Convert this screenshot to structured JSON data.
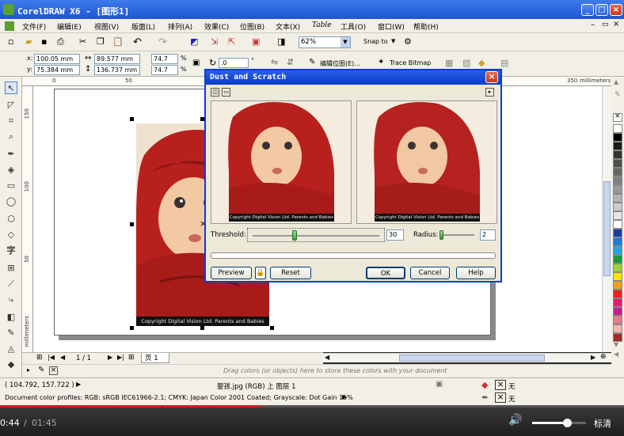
{
  "window": {
    "title": "CorelDRAW X6 - [图形1]"
  },
  "menu": [
    "文件(F)",
    "编辑(E)",
    "视图(V)",
    "版面(L)",
    "排列(A)",
    "效果(C)",
    "位图(B)",
    "文本(X)",
    "Table",
    "工具(O)",
    "窗口(W)",
    "帮助(H)"
  ],
  "toolbar": {
    "zoom": "62%",
    "snap_to": "Snap to",
    "edit_bitmap": "编辑位图(E)...",
    "trace_bitmap": "Trace Bitmap"
  },
  "props": {
    "x": "100.05 mm",
    "y": "75.384 mm",
    "w": "89.577 mm",
    "h": "136.737 mm",
    "sx": "74.7",
    "sy": "74.7",
    "pct": "%",
    "rotation": ".0",
    "deg": "°"
  },
  "ruler": {
    "unit": "millimeters",
    "h_ticks": [
      "0",
      "50",
      "350"
    ],
    "v_ticks": [
      "150",
      "100",
      "50"
    ],
    "v_unit": "millimeters"
  },
  "photo": {
    "caption": "Copyright Digital Vision Ltd. Parents and Babies"
  },
  "dialog": {
    "title": "Dust and Scratch",
    "threshold_label": "Threshold:",
    "threshold_value": "30",
    "radius_label": "Radius:",
    "radius_value": "2",
    "preview_label": "Preview",
    "reset_label": "Reset",
    "ok_label": "OK",
    "cancel_label": "Cancel",
    "help_label": "Help",
    "preview_caption": "Copyright Digital Vision Ltd. Parents and Babies"
  },
  "pagenav": {
    "counter": "1 / 1",
    "tab": "页 1"
  },
  "dropbar": {
    "hint": "Drag colors (or objects) here to store these colors with your document"
  },
  "status": {
    "coords": "( 104.792, 157.722 )",
    "object_info": "婴孩.jpg (RGB) 上 图层 1",
    "profiles": "Document color profiles: RGB: sRGB IEC61966-2.1; CMYK: Japan Color 2001 Coated; Grayscale: Dot Gain 15%",
    "fill_none": "无",
    "outline_none": "无"
  },
  "video": {
    "current": "0:44",
    "separator": "/",
    "duration": "01:45",
    "cc": "标清",
    "progress": 0.42,
    "volume": 0.65
  },
  "palette": [
    "#ffffff",
    "#000000",
    "#1a1a1a",
    "#333333",
    "#4d4d4d",
    "#666666",
    "#808080",
    "#999999",
    "#b3b3b3",
    "#cccccc",
    "#e6e6e6",
    "#ffffff",
    "#1c3f9e",
    "#1e7ad6",
    "#24a3e0",
    "#1a9a3c",
    "#9fcf3a",
    "#f5e500",
    "#f0a020",
    "#e8231e",
    "#e21c74",
    "#c31e8c",
    "#e87a8a",
    "#f5b5b5",
    "#a52a2a"
  ],
  "colors": {
    "titlebar": "#1d55d6",
    "red_accent": "#d21c1c",
    "dialog_border": "#0a3cd6"
  }
}
